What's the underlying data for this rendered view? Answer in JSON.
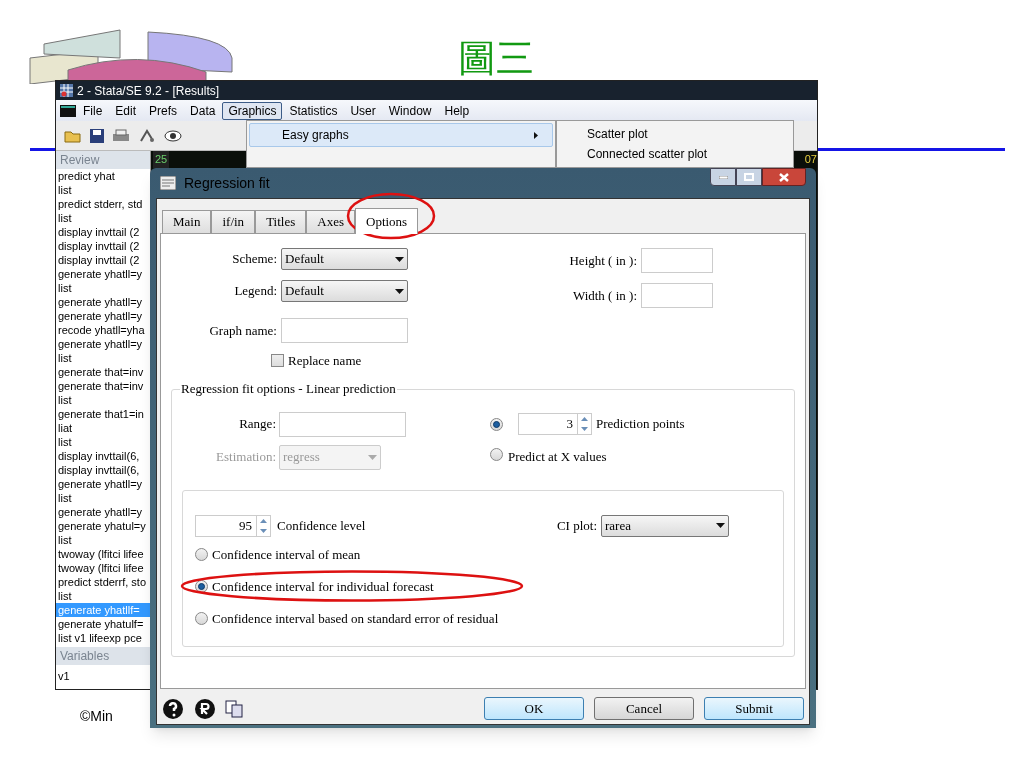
{
  "slide": {
    "title": "圖三",
    "footer": "©Min"
  },
  "stata": {
    "title": "2 - Stata/SE 9.2 - [Results]",
    "menu": [
      {
        "label": "File",
        "selected": false
      },
      {
        "label": "Edit",
        "selected": false
      },
      {
        "label": "Prefs",
        "selected": false
      },
      {
        "label": "Data",
        "selected": false
      },
      {
        "label": "Graphics",
        "selected": true
      },
      {
        "label": "Statistics",
        "selected": false
      },
      {
        "label": "User",
        "selected": false
      },
      {
        "label": "Window",
        "selected": false
      },
      {
        "label": "Help",
        "selected": false
      }
    ],
    "open_menu": [
      {
        "label": "Easy graphs",
        "selected": true
      }
    ],
    "submenu": [
      {
        "label": "Scatter plot"
      },
      {
        "label": "Connected scatter plot"
      }
    ],
    "results_fragments": [
      "25",
      "07"
    ],
    "review": {
      "heading": "Review",
      "items": [
        {
          "text": "predict yhat",
          "selected": false
        },
        {
          "text": "list",
          "selected": false
        },
        {
          "text": "predict stderr, std",
          "selected": false
        },
        {
          "text": "list",
          "selected": false
        },
        {
          "text": "display invttail (2",
          "selected": false
        },
        {
          "text": "display invttail (2",
          "selected": false
        },
        {
          "text": "display invttail (2",
          "selected": false
        },
        {
          "text": "generate yhatll=y",
          "selected": false
        },
        {
          "text": "list",
          "selected": false
        },
        {
          "text": "generate yhatll=y",
          "selected": false
        },
        {
          "text": "generate yhatll=y",
          "selected": false
        },
        {
          "text": "recode yhatll=yha",
          "selected": false
        },
        {
          "text": "generate yhatll=y",
          "selected": false
        },
        {
          "text": "list",
          "selected": false
        },
        {
          "text": "generate that=inv",
          "selected": false
        },
        {
          "text": "generate that=inv",
          "selected": false
        },
        {
          "text": "list",
          "selected": false
        },
        {
          "text": "generate that1=in",
          "selected": false
        },
        {
          "text": "liat",
          "selected": false
        },
        {
          "text": "list",
          "selected": false
        },
        {
          "text": "display invttail(6,",
          "selected": false
        },
        {
          "text": "display invttail(6,",
          "selected": false
        },
        {
          "text": "generate yhatll=y",
          "selected": false
        },
        {
          "text": "list",
          "selected": false
        },
        {
          "text": "generate yhatll=y",
          "selected": false
        },
        {
          "text": "generate yhatul=y",
          "selected": false
        },
        {
          "text": "list",
          "selected": false
        },
        {
          "text": "twoway (lfitci lifee",
          "selected": false
        },
        {
          "text": "twoway (lfitci lifee",
          "selected": false
        },
        {
          "text": "predict stderrf, sto",
          "selected": false
        },
        {
          "text": "list",
          "selected": false
        },
        {
          "text": "generate yhatllf=",
          "selected": true
        },
        {
          "text": "generate yhatulf=",
          "selected": false
        },
        {
          "text": "list v1 lifeexp pce",
          "selected": false
        }
      ]
    },
    "variables": {
      "heading": "Variables",
      "items": [
        "v1"
      ]
    }
  },
  "dialog": {
    "title": "Regression fit",
    "tabs": [
      {
        "label": "Main",
        "selected": false
      },
      {
        "label": "if/in",
        "selected": false
      },
      {
        "label": "Titles",
        "selected": false
      },
      {
        "label": "Axes",
        "selected": false
      },
      {
        "label": "Options",
        "selected": true
      }
    ],
    "scheme": {
      "label": "Scheme:",
      "value": "Default"
    },
    "legend": {
      "label": "Legend:",
      "value": "Default"
    },
    "height": {
      "label": "Height ( in ):"
    },
    "width": {
      "label": "Width ( in ):"
    },
    "graph_name": {
      "label": "Graph name:"
    },
    "replace_name": {
      "label": "Replace name",
      "checked": false
    },
    "fit_group": {
      "title": "Regression fit options - Linear prediction",
      "range": {
        "label": "Range:"
      },
      "estimation": {
        "label": "Estimation:",
        "value": "regress",
        "disabled": true
      },
      "prediction_points": {
        "label": "Prediction points",
        "value": "3",
        "selected": true
      },
      "predict_x": {
        "label": "Predict at X values",
        "selected": false
      }
    },
    "ci_group": {
      "confidence": {
        "value": "95",
        "label": "Confidence level"
      },
      "ci_plot": {
        "label": "CI plot:",
        "value": "rarea"
      },
      "options": [
        {
          "label": "Confidence interval of mean",
          "selected": false
        },
        {
          "label": "Confidence interval for individual forecast",
          "selected": true
        },
        {
          "label": "Confidence interval based on standard error of residual",
          "selected": false
        }
      ]
    },
    "buttons": [
      "OK",
      "Cancel",
      "Submit"
    ]
  }
}
